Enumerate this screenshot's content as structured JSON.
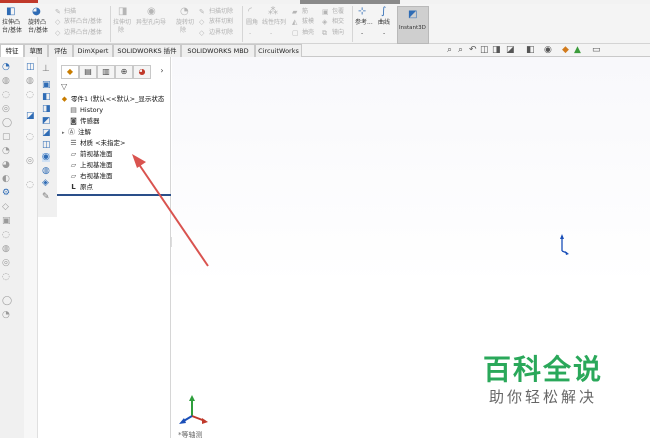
{
  "ribbon": {
    "extrude_label_1": "拉伸凸",
    "extrude_label_2": "台/基体",
    "revolve_label_1": "旋转凸",
    "revolve_label_2": "台/基体",
    "sweep": "扫描",
    "loft": "放样凸台/基体",
    "boundary": "边界凸台/基体",
    "extrude_cut_1": "拉伸切",
    "extrude_cut_2": "除",
    "hole_wizard": "异型孔向导",
    "revolve_cut_1": "旋转切",
    "revolve_cut_2": "除",
    "swept_cut": "扫描切除",
    "lofted_cut": "放样切割",
    "boundary_cut": "边界切除",
    "fillet": "圆角",
    "linear_pattern": "线性阵列",
    "rib": "筋",
    "wrap": "包覆",
    "draft": "拔模",
    "intersect": "相交",
    "shell": "抽壳",
    "mirror": "镜向",
    "reference": "参考...",
    "curves": "曲线",
    "instant3d": "Instant3D",
    "dash": "-"
  },
  "tabs": [
    "特征",
    "草图",
    "评估",
    "DimXpert",
    "SOLIDWORKS 插件",
    "SOLIDWORKS MBD",
    "CircuitWorks"
  ],
  "tree": {
    "root": "零件1 (默认<<默认>_显示状态",
    "history": "History",
    "sensors": "传感器",
    "annotations": "注解",
    "material": "材质 <未指定>",
    "front_plane": "前视基准面",
    "top_plane": "上视基准面",
    "right_plane": "右视基准面",
    "origin": "原点"
  },
  "watermark": {
    "main": "百科全说",
    "sub": "助你轻松解决"
  },
  "bottom_label": "*等轴测",
  "colors": {
    "accent": "#2f6cb5",
    "arrow": "#d9534f",
    "watermark_green": "#2aa85a"
  }
}
